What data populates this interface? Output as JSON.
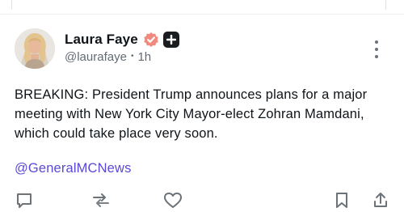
{
  "post": {
    "author": {
      "display_name": "Laura Faye",
      "handle": "@laurafaye",
      "time_ago": "1h",
      "separator": "•",
      "verified_badge_color": "#f08a7e",
      "plus_badge_color": "#1a1d20"
    },
    "text": "BREAKING: President Trump announces plans for a major meeting with New York City Mayor-elect Zohran Mamdani, which could take place very soon.",
    "mention": "@GeneralMCNews",
    "mention_color": "#5b49d6",
    "actions": [
      {
        "icon": "reply-icon"
      },
      {
        "icon": "repost-icon"
      },
      {
        "icon": "like-icon"
      },
      {
        "icon": "bookmark-icon"
      },
      {
        "icon": "share-icon"
      }
    ]
  },
  "colors": {
    "text_primary": "#0f1419",
    "text_secondary": "#636b73",
    "divider": "#ebeef0"
  }
}
